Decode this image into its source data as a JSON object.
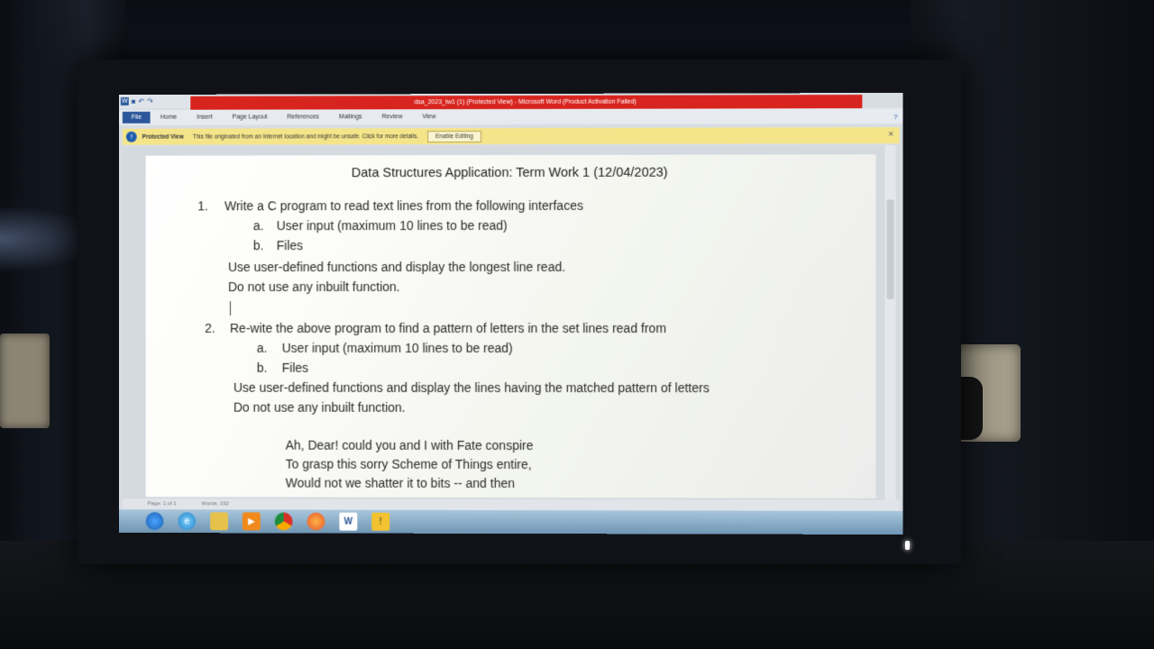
{
  "window": {
    "title": "dsa_2023_tw1 (1) (Protected View) - Microsoft Word (Product Activation Failed)"
  },
  "ribbon": {
    "tabs": [
      "File",
      "Home",
      "Insert",
      "Page Layout",
      "References",
      "Mailings",
      "Review",
      "View"
    ]
  },
  "protected_view": {
    "title": "Protected View",
    "message": "This file originated from an Internet location and might be unsafe. Click for more details.",
    "button": "Enable Editing"
  },
  "document": {
    "title": "Data Structures Application: Term Work 1 (12/04/2023)",
    "q1": {
      "num": "1.",
      "text": "Write a C program to read  text lines  from the following interfaces",
      "a_label": "a.",
      "a_text": "User input (maximum 10 lines to be read)",
      "b_label": "b.",
      "b_text": "Files",
      "note1": "Use user-defined functions and display the longest line read.",
      "note2": "Do not use any inbuilt function."
    },
    "q2": {
      "num": "2.",
      "text": "Re-wite the above program to find a pattern of letters in the set lines read from",
      "a_label": "a.",
      "a_text": "User input (maximum 10 lines to be read)",
      "b_label": "b.",
      "b_text": "Files",
      "note1": "Use user-defined functions and display the lines having the matched pattern of letters",
      "note2": "Do not use any inbuilt function."
    },
    "poem": [
      "Ah, Dear! could you and I with Fate conspire",
      "To grasp this sorry Scheme of Things entire,",
      "Would not we shatter it to bits -- and then"
    ]
  },
  "statusbar": {
    "page": "Page: 1 of 1",
    "words": "Words: 192"
  },
  "colors": {
    "titlebar_error": "#d8241e",
    "word_blue": "#2b579a",
    "protected_bar": "#f5e58a"
  }
}
